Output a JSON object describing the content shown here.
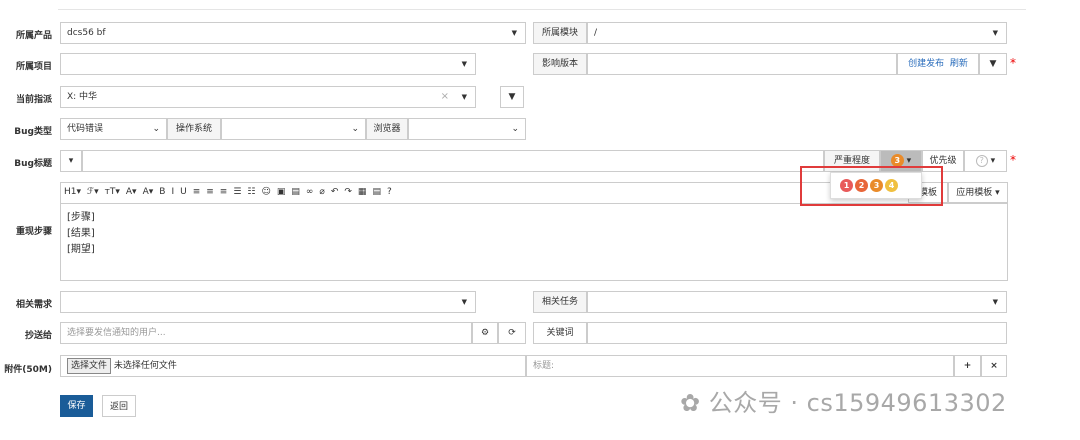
{
  "form": {
    "product_label": "所属产品",
    "product_value": "dcs56 bf",
    "module_label": "所属模块",
    "module_value": "/",
    "project_label": "所属项目",
    "version_label": "影响版本",
    "create_release": "创建发布",
    "refresh": "刷新",
    "assign_label": "当前指派",
    "assign_value": "X: 中华",
    "clear_x": "×",
    "bugtype_label": "Bug类型",
    "bugtype_value": "代码错误",
    "os_label": "操作系统",
    "browser_label": "浏览器",
    "title_label": "Bug标题",
    "severity_label": "严重程度",
    "severity_value": "3",
    "priority_label": "优先级",
    "priority_value": "?",
    "steps_label": "重现步骤",
    "steps_lines": [
      "[步骤]",
      "[结果]",
      "[期望]"
    ],
    "template_label": "模板",
    "apply_template": "应用模板",
    "story_label": "相关需求",
    "task_label": "相关任务",
    "cc_label": "抄送给",
    "cc_placeholder": "选择要发信通知的用户...",
    "keywords_label": "关键词",
    "attach_label": "附件(50M)",
    "choose_file": "选择文件",
    "no_file": "未选择任何文件",
    "file_title_placeholder": "标题:",
    "save": "保存",
    "back": "返回"
  },
  "severity_options": [
    {
      "num": "1",
      "color": "#e85a5a"
    },
    {
      "num": "2",
      "color": "#e8663a"
    },
    {
      "num": "3",
      "color": "#e98b2a"
    },
    {
      "num": "4",
      "color": "#f0c040"
    }
  ],
  "toolbar": [
    "H1▾",
    "ℱ▾",
    "тT▾",
    "A▾",
    "A▾",
    "B",
    "I",
    "U",
    "≡",
    "≡",
    "≡",
    "☰",
    "☷",
    "☺",
    "▣",
    "▤",
    "∞",
    "⌀",
    "↶",
    "↷",
    "▦",
    "▤",
    "?"
  ],
  "watermark": "公众号 · cs15949613302"
}
